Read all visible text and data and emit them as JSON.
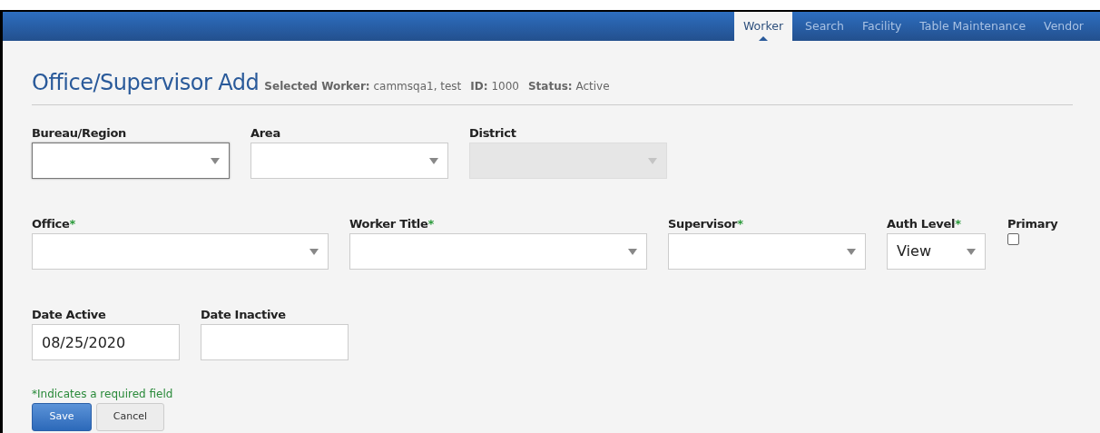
{
  "nav": {
    "tabs": [
      {
        "label": "Worker",
        "selected": true
      },
      {
        "label": "Search",
        "selected": false
      },
      {
        "label": "Facility",
        "selected": false
      },
      {
        "label": "Table Maintenance",
        "selected": false
      },
      {
        "label": "Vendor",
        "selected": false
      }
    ]
  },
  "header": {
    "title": "Office/Supervisor Add",
    "details": [
      {
        "label": "Selected Worker:",
        "value": "cammsqa1, test"
      },
      {
        "label": "ID:",
        "value": "1000"
      },
      {
        "label": "Status:",
        "value": "Active"
      }
    ]
  },
  "form": {
    "rows": [
      [
        {
          "label": "Bureau/Region",
          "kind": "select",
          "required": false,
          "disabled": false,
          "focused": true
        },
        {
          "label": "Area",
          "kind": "select",
          "required": false,
          "disabled": false,
          "focused": false
        },
        {
          "label": "District",
          "kind": "select",
          "required": false,
          "disabled": true,
          "focused": false
        }
      ],
      [
        {
          "label": "Office",
          "kind": "select",
          "required": true,
          "disabled": false
        },
        {
          "label": "Worker Title",
          "kind": "select",
          "required": true,
          "disabled": false
        },
        {
          "label": "Supervisor",
          "kind": "select",
          "required": true,
          "disabled": false
        },
        {
          "label": "Auth Level",
          "kind": "select",
          "required": true,
          "disabled": false,
          "value": "View"
        },
        {
          "label": "Primary",
          "kind": "checkbox",
          "required": false,
          "checked": false
        }
      ],
      [
        {
          "label": "Date Active",
          "kind": "text",
          "required": false,
          "disabled": false,
          "value": "08/25/2020"
        },
        {
          "label": "Date Inactive",
          "kind": "text",
          "required": false,
          "disabled": false
        }
      ]
    ],
    "required_mark": "*",
    "note": "*Indicates a required field",
    "buttons": [
      {
        "label": "Save",
        "kind": "primary"
      },
      {
        "label": "Cancel",
        "kind": "secondary"
      }
    ]
  }
}
